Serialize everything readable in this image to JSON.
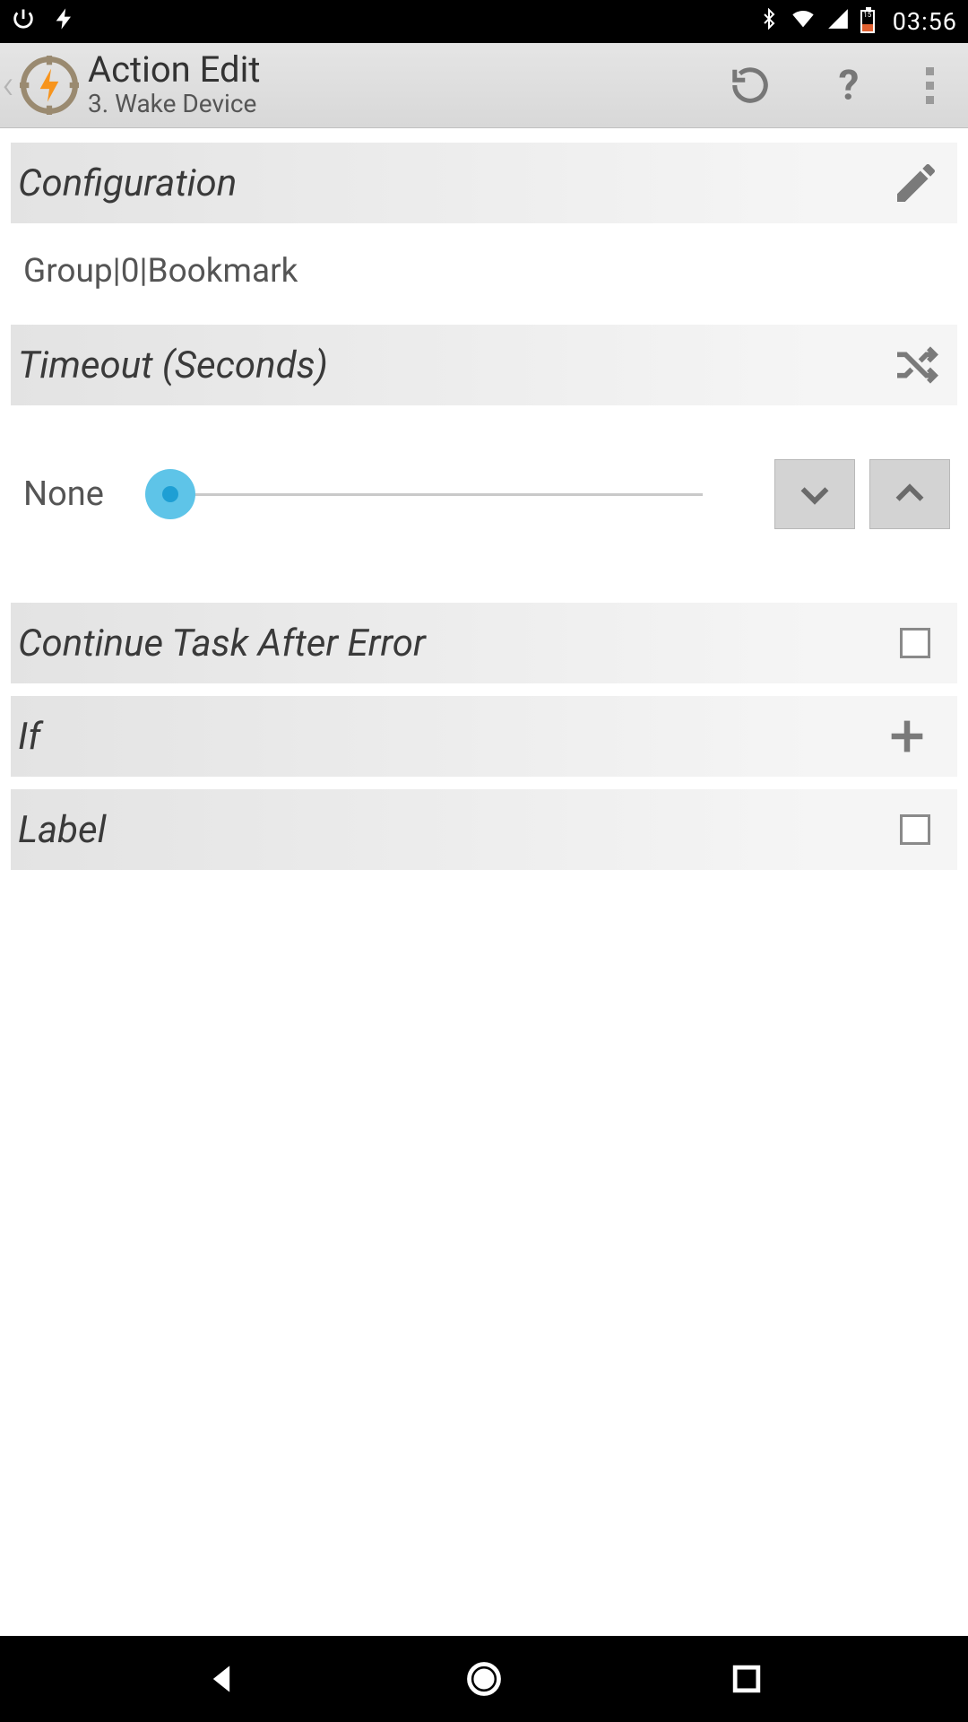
{
  "status": {
    "time": "03:56",
    "battery_level": "15"
  },
  "header": {
    "title": "Action Edit",
    "subtitle": "3. Wake Device"
  },
  "sections": {
    "configuration": {
      "label": "Configuration",
      "value": "Group|0|Bookmark"
    },
    "timeout": {
      "label": "Timeout (Seconds)",
      "value": "None"
    },
    "continue_after_error": {
      "label": "Continue Task After Error"
    },
    "if": {
      "label": "If"
    },
    "label_section": {
      "label": "Label"
    }
  }
}
